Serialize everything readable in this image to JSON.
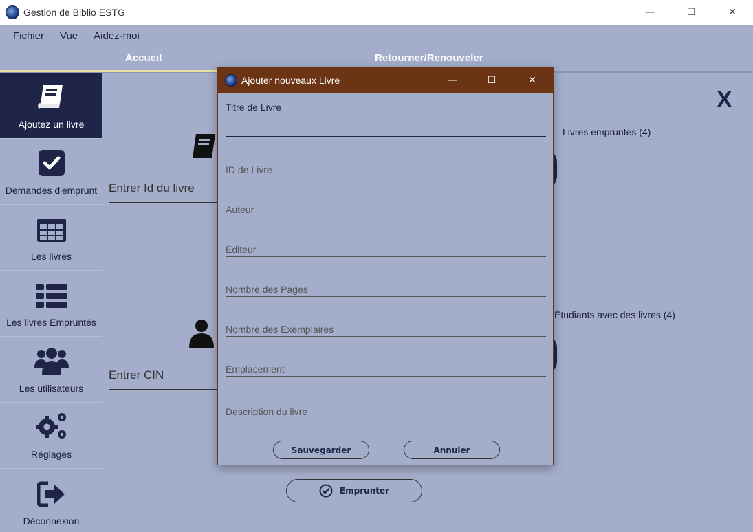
{
  "window": {
    "title": "Gestion de Biblio ESTG",
    "minimize_icon": "—",
    "maximize_icon": "☐",
    "close_icon": "✕"
  },
  "menu": [
    "Fichier",
    "Vue",
    "Aidez-moi"
  ],
  "tabs": [
    "Accueil",
    "Retourner/Renouveler"
  ],
  "sidebar": [
    {
      "label": "Ajoutez un livre",
      "icon": "book-icon",
      "active": true
    },
    {
      "label": "Demandes d'emprunt",
      "icon": "checkbox-icon"
    },
    {
      "label": "Les livres",
      "icon": "table-icon"
    },
    {
      "label": "Les livres Empruntés",
      "icon": "list-icon"
    },
    {
      "label": "Les utilisateurs",
      "icon": "users-icon"
    },
    {
      "label": "Réglages",
      "icon": "gears-icon"
    },
    {
      "label": "Déconnexion",
      "icon": "logout-icon"
    }
  ],
  "main": {
    "close": "X",
    "book_id_placeholder": "Entrer Id du livre",
    "cin_placeholder": "Entrer CIN",
    "borrowed_books": "Livres empruntés (4)",
    "students_with_books": "Étudiants avec des livres (4)",
    "borrow_button": "Emprunter"
  },
  "dialog": {
    "title": "Ajouter nouveaux Livre",
    "title_label": "Titre de Livre",
    "title_value": "",
    "fields": [
      "ID de Livre",
      "Auteur",
      "Éditeur",
      "Nombre des Pages",
      "Nombre des Exemplaires",
      "Emplacement",
      "Description du livre"
    ],
    "save_button": "Sauvegarder",
    "cancel_button": "Annuler"
  }
}
